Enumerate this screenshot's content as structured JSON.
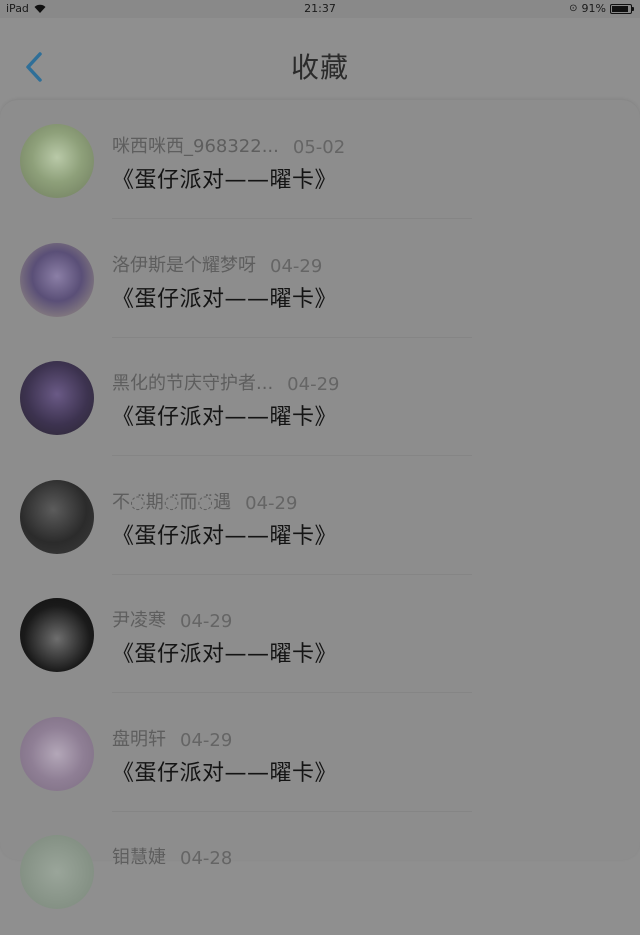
{
  "status_bar": {
    "device": "iPad",
    "time": "21:37",
    "battery": "91%",
    "battery_level": 0.91
  },
  "header": {
    "title": "收藏"
  },
  "favorites": [
    {
      "name": "咪西咪西_968322...",
      "date": "05-02",
      "subject": "《蛋仔派对——曜卡》"
    },
    {
      "name": "洛伊斯是个耀梦呀",
      "date": "04-29",
      "subject": "《蛋仔派对——曜卡》"
    },
    {
      "name": "黑化的节庆守护者...",
      "date": "04-29",
      "subject": "《蛋仔派对——曜卡》"
    },
    {
      "name": "不◌̈期◌̈而◌̈遇",
      "date": "04-29",
      "subject": "《蛋仔派对——曜卡》"
    },
    {
      "name": "尹凌寒",
      "date": "04-29",
      "subject": "《蛋仔派对——曜卡》"
    },
    {
      "name": "盘明轩",
      "date": "04-29",
      "subject": "《蛋仔派对——曜卡》"
    },
    {
      "name": "钼慧婕",
      "date": "04-28",
      "subject": ""
    }
  ]
}
